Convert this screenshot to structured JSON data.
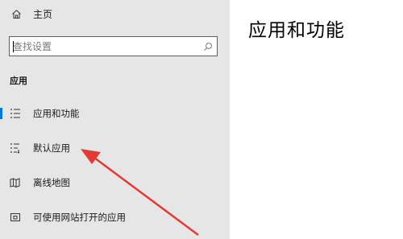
{
  "sidebar": {
    "home_label": "主页",
    "search_placeholder": "查找设置",
    "section_title": "应用",
    "items": [
      {
        "label": "应用和功能",
        "icon": "list-icon",
        "active": true
      },
      {
        "label": "默认应用",
        "icon": "default-apps-icon",
        "active": false
      },
      {
        "label": "离线地图",
        "icon": "map-icon",
        "active": false
      },
      {
        "label": "可使用网站打开的应用",
        "icon": "open-in-app-icon",
        "active": false
      }
    ]
  },
  "main": {
    "title": "应用和功能"
  },
  "colors": {
    "accent": "#0078d7",
    "sidebar_bg": "#e6e6e6",
    "annotation_arrow": "#e53935"
  }
}
